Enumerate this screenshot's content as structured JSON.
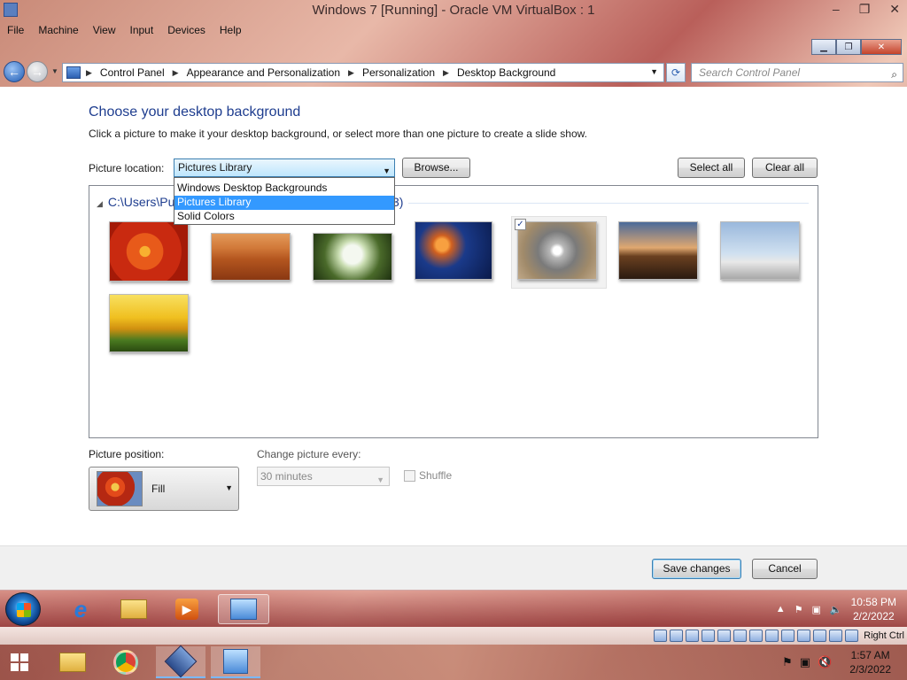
{
  "vbox": {
    "title": "Windows 7 [Running] - Oracle VM VirtualBox : 1",
    "controls": [
      "–",
      "❐",
      "✕"
    ],
    "menu": [
      "File",
      "Machine",
      "View",
      "Input",
      "Devices",
      "Help"
    ],
    "host_key": "Right Ctrl"
  },
  "explorer": {
    "frame_controls": [
      "▁",
      "❐",
      "✕"
    ],
    "breadcrumbs": [
      "Control Panel",
      "Appearance and Personalization",
      "Personalization",
      "Desktop Background"
    ],
    "search_placeholder": "Search Control Panel"
  },
  "page": {
    "title": "Choose your desktop background",
    "description": "Click a picture to make it your desktop background, or select more than one picture to create a slide show.",
    "location_label": "Picture location:",
    "location_value": "Pictures Library",
    "location_options": [
      {
        "label": "Windows Desktop Backgrounds",
        "selected": false
      },
      {
        "label": "Pictures Library",
        "selected": true
      },
      {
        "label": "Solid Colors",
        "selected": false
      }
    ],
    "browse_label": "Browse...",
    "select_all_label": "Select all",
    "clear_all_label": "Clear all",
    "group_header": "C:\\Users\\Pu",
    "group_header_tail": "3)",
    "thumbnails": [
      {
        "name": "Chrysanthemum",
        "selected": false
      },
      {
        "name": "Desert",
        "selected": false
      },
      {
        "name": "Hydrangeas",
        "selected": false
      },
      {
        "name": "Jellyfish",
        "selected": false
      },
      {
        "name": "Koala",
        "selected": true
      },
      {
        "name": "Lighthouse",
        "selected": false
      },
      {
        "name": "Penguins",
        "selected": false
      },
      {
        "name": "Tulips",
        "selected": false
      }
    ],
    "position_label": "Picture position:",
    "position_value": "Fill",
    "change_label": "Change picture every:",
    "change_value": "30 minutes",
    "shuffle_label": "Shuffle",
    "save_label": "Save changes",
    "cancel_label": "Cancel"
  },
  "guest_taskbar": {
    "time": "10:58 PM",
    "date": "2/2/2022"
  },
  "host_taskbar": {
    "time": "1:57 AM",
    "date": "2/3/2022"
  }
}
